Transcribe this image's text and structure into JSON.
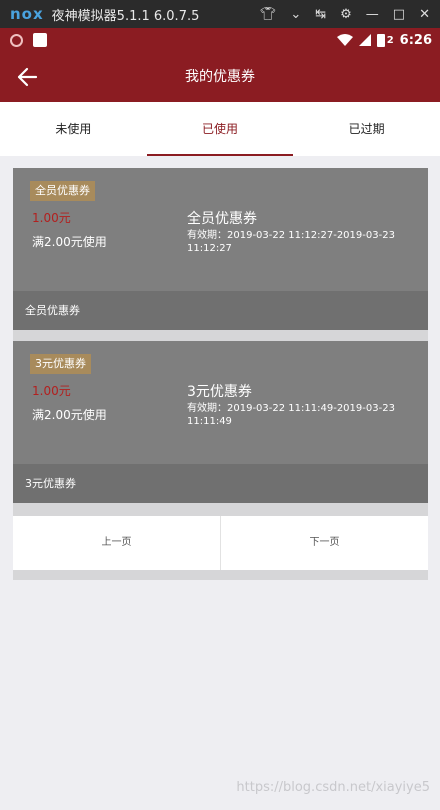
{
  "emulator": {
    "logo": "nox",
    "title": "夜神模拟器5.1.1 6.0.7.5",
    "controls": [
      "shirt-icon",
      "chevron-down-icon",
      "pin-icon",
      "gear-icon",
      "minimize-icon",
      "maximize-icon",
      "close-icon"
    ]
  },
  "status_bar": {
    "time": "6:26",
    "battery_label": "2",
    "bg_color": "#8b1c22"
  },
  "header": {
    "title": "我的优惠券",
    "accent_color": "#8b1c22"
  },
  "tabs": [
    {
      "label": "未使用",
      "active": false
    },
    {
      "label": "已使用",
      "active": true
    },
    {
      "label": "已过期",
      "active": false
    }
  ],
  "coupons": [
    {
      "badge": "全员优惠券",
      "amount": "1.00元",
      "condition": "满2.00元使用",
      "name": "全员优惠券",
      "validity": "有效期：2019-03-22 11:12:27-2019-03-23 11:12:27",
      "footer": "全员优惠券"
    },
    {
      "badge": "3元优惠券",
      "amount": "1.00元",
      "condition": "满2.00元使用",
      "name": "3元优惠券",
      "validity": "有效期：2019-03-22 11:11:49-2019-03-23 11:11:49",
      "footer": "3元优惠券"
    }
  ],
  "pager": {
    "prev": "上一页",
    "next": "下一页"
  },
  "watermark": "https://blog.csdn.net/xiayiye5"
}
